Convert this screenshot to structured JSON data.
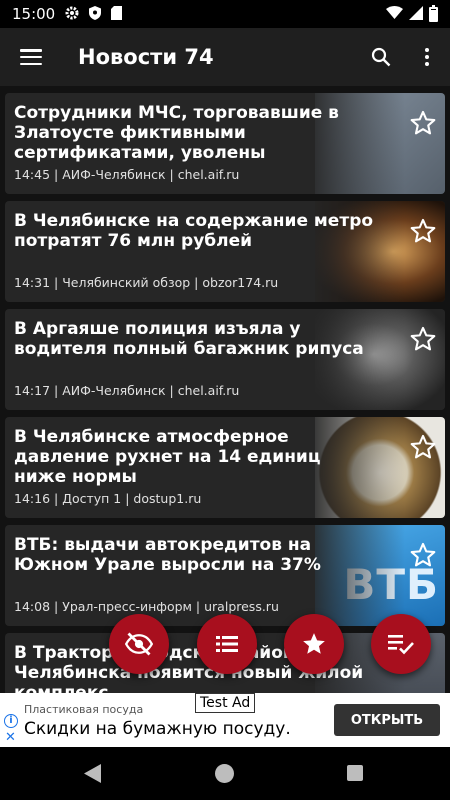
{
  "status_bar": {
    "time": "15:00",
    "icons": [
      "gear-icon",
      "shield-icon",
      "sd-card-icon",
      "wifi-icon",
      "signal-icon",
      "battery-icon"
    ]
  },
  "app_bar": {
    "title": "Новости 74",
    "icons": [
      "menu-icon",
      "search-icon",
      "more-vert-icon"
    ]
  },
  "news": [
    {
      "title": "Сотрудники МЧС, торговавшие в Златоусте фиктивными сертификатами, уволены",
      "time": "14:45",
      "source": "| АИФ-Челябинск | chel.aif.ru",
      "thumb_color": "#7b8a99"
    },
    {
      "title": "В Челябинске на содержание метро потратят 76 млн рублей",
      "time": "14:31",
      "source": "| Челябинский обзор | obzor174.ru",
      "thumb_color": "#6a3d1c"
    },
    {
      "title": "В Аргаяше полиция изъяла у водителя полный багажник рипуса",
      "time": "14:17",
      "source": "| АИФ-Челябинск | chel.aif.ru",
      "thumb_color": "#3c3c3c"
    },
    {
      "title": "В Челябинске атмосферное давление рухнет на 14 единиц ниже нормы",
      "time": "14:16",
      "source": "| Доступ 1 | dostup1.ru",
      "thumb_color": "#9b7a45"
    },
    {
      "title": "ВТБ: выдачи автокредитов на Южном Урале выросли на 37%",
      "time": "14:08",
      "source": "| Урал-пресс-информ | uralpress.ru",
      "thumb_color": "#2b8fd6",
      "thumb_text": "ВТБ"
    },
    {
      "title": "В Тракторозаводском районе Челябинска появится новый жилой комплекс",
      "time": "",
      "source": "",
      "thumb_color": "#4a4f57"
    }
  ],
  "fabs": [
    "hide-icon",
    "list-icon",
    "star-icon",
    "read-check-icon"
  ],
  "fab_color": "#a80f1e",
  "ad": {
    "label": "Test Ad",
    "subtitle": "Пластиковая посуда",
    "text": "Скидки на бумажную посуду.",
    "button": "ОТКРЫТЬ",
    "info_glyph": "i",
    "close_glyph": "✕"
  },
  "nav_bar": {
    "icons": [
      "back-icon",
      "home-icon",
      "recents-icon"
    ]
  }
}
